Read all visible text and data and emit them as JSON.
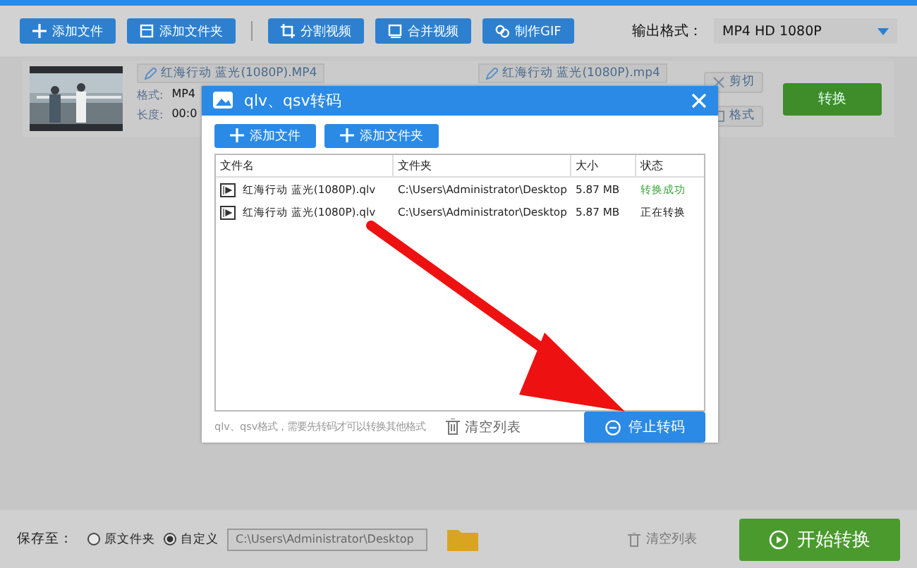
{
  "toolbar": {
    "buttons": [
      {
        "label": "添加文件"
      },
      {
        "label": "添加文件夹"
      },
      {
        "label": "分割视频"
      },
      {
        "label": "合并视频"
      },
      {
        "label": "制作GIF"
      }
    ],
    "output_label": "输出格式：",
    "output_format": "MP4  HD 1080P"
  },
  "file_card": {
    "source_name": "红海行动 蓝光(1080P).MP4",
    "format_label": "格式:",
    "format_value": "MP4",
    "length_label": "长度:",
    "length_value": "00:0",
    "output_name": "红海行动 蓝光(1080P).mp4",
    "actions": [
      "剪切",
      "格式"
    ],
    "convert": "转换"
  },
  "dialog": {
    "title": "qlv、qsv转码",
    "buttons": [
      "添加文件",
      "添加文件夹"
    ],
    "columns": [
      "文件名",
      "文件夹",
      "大小",
      "状态"
    ],
    "rows": [
      {
        "name": "红海行动 蓝光(1080P).qlv",
        "folder": "C:\\Users\\Administrator\\Desktop",
        "size": "5.87 MB",
        "status": "转换成功",
        "color": "#3aa63a"
      },
      {
        "name": "红海行动 蓝光(1080P).qlv",
        "folder": "C:\\Users\\Administrator\\Desktop",
        "size": "5.87 MB",
        "status": "正在转换",
        "color": "#222222"
      }
    ],
    "hint": "qlv、qsv格式，需要先转码才可以转换其他格式",
    "clear": "清空列表",
    "stop": "停止转码"
  },
  "bottom": {
    "save_label": "保存至：",
    "options": [
      {
        "label": "原文件夹",
        "selected": false
      },
      {
        "label": "自定义",
        "selected": true
      }
    ],
    "path": "C:\\Users\\Administrator\\Desktop",
    "clear": "清空列表",
    "start": "开始转换"
  }
}
